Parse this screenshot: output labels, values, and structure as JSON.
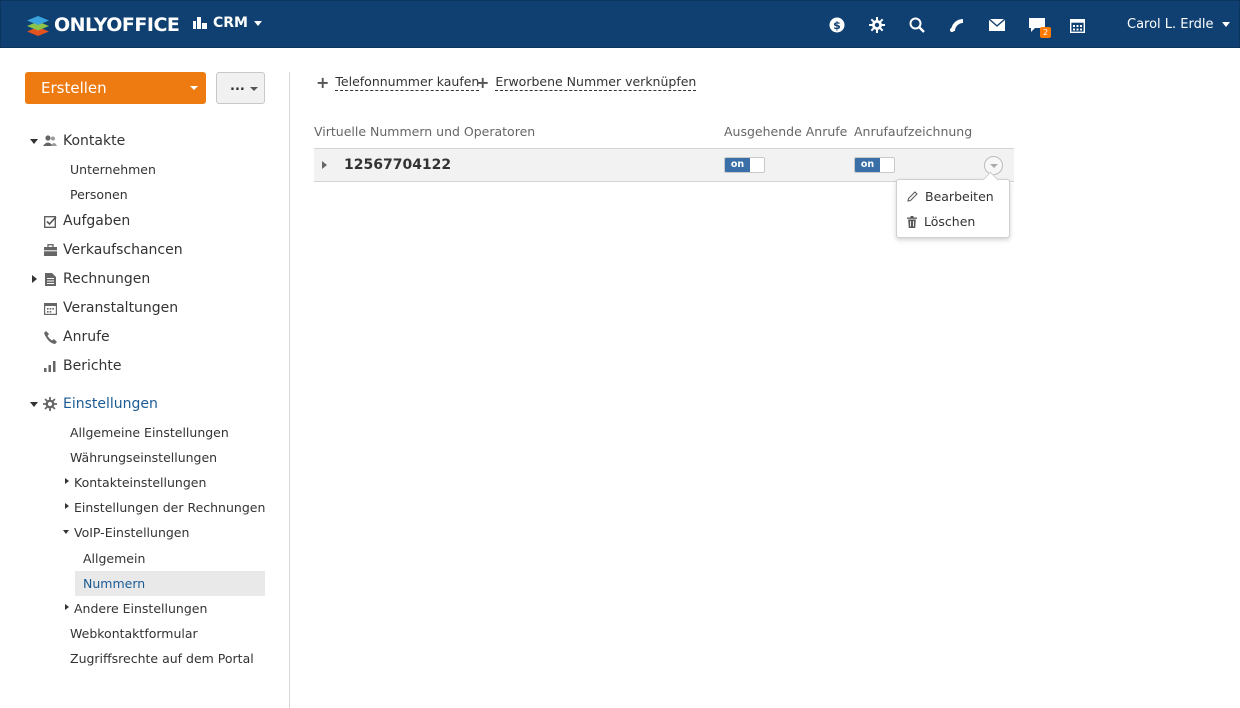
{
  "header": {
    "logo_text": "ONLYOFFICE",
    "module_label": "CRM",
    "user_name": "Carol L. Erdle",
    "chat_badge": "2",
    "bg_color": "#0f4071"
  },
  "sidebar": {
    "create_label": "Erstellen",
    "more_label": "...",
    "items": {
      "contacts": "Kontakte",
      "companies": "Unternehmen",
      "persons": "Personen",
      "tasks": "Aufgaben",
      "opportunities": "Verkaufschancen",
      "invoices": "Rechnungen",
      "events": "Veranstaltungen",
      "calls": "Anrufe",
      "reports": "Berichte",
      "settings": "Einstellungen"
    },
    "settings_items": {
      "general": "Allgemeine Einstellungen",
      "currency": "Währungseinstellungen",
      "contact_settings": "Kontakteinstellungen",
      "invoice_settings": "Einstellungen der Rechnungen",
      "voip": "VoIP-Einstellungen",
      "voip_general": "Allgemein",
      "voip_numbers": "Nummern",
      "other": "Andere Einstellungen",
      "web_form": "Webkontaktformular",
      "access": "Zugriffsrechte auf dem Portal"
    }
  },
  "content": {
    "buy_number": "Telefonnummer kaufen",
    "link_number": "Erworbene Nummer verknüpfen",
    "columns": {
      "numbers": "Virtuelle Nummern und Operatoren",
      "outgoing": "Ausgehende Anrufe",
      "recording": "Anrufaufzeichnung"
    },
    "row": {
      "number": "12567704122",
      "outgoing_toggle": "on",
      "recording_toggle": "on"
    },
    "menu": {
      "edit": "Bearbeiten",
      "delete": "Löschen"
    }
  }
}
